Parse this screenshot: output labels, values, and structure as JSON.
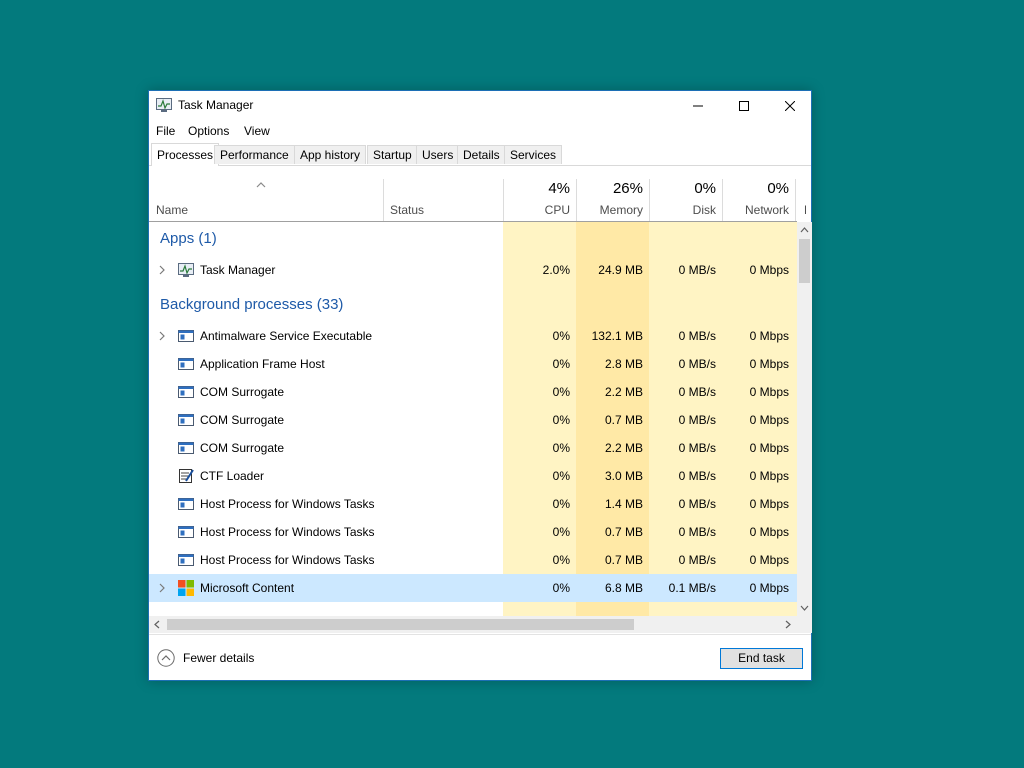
{
  "window": {
    "title": "Task Manager"
  },
  "menu": [
    "File",
    "Options",
    "View"
  ],
  "tabs": [
    "Processes",
    "Performance",
    "App history",
    "Startup",
    "Users",
    "Details",
    "Services"
  ],
  "columns": {
    "name": "Name",
    "status": "Status",
    "cpu": {
      "pct": "4%",
      "label": "CPU"
    },
    "memory": {
      "pct": "26%",
      "label": "Memory"
    },
    "disk": {
      "pct": "0%",
      "label": "Disk"
    },
    "network": {
      "pct": "0%",
      "label": "Network"
    },
    "power": "P"
  },
  "groups": {
    "apps": "Apps (1)",
    "background": "Background processes (33)"
  },
  "apps": [
    {
      "name": "Task Manager",
      "cpu": "2.0%",
      "memory": "24.9 MB",
      "disk": "0 MB/s",
      "network": "0 Mbps",
      "icon": "task-manager-icon",
      "expandable": true
    }
  ],
  "background": [
    {
      "name": "Antimalware Service Executable",
      "cpu": "0%",
      "memory": "132.1 MB",
      "disk": "0 MB/s",
      "network": "0 Mbps",
      "icon": "app-window-icon",
      "expandable": true
    },
    {
      "name": "Application Frame Host",
      "cpu": "0%",
      "memory": "2.8 MB",
      "disk": "0 MB/s",
      "network": "0 Mbps",
      "icon": "app-window-icon",
      "expandable": false
    },
    {
      "name": "COM Surrogate",
      "cpu": "0%",
      "memory": "2.2 MB",
      "disk": "0 MB/s",
      "network": "0 Mbps",
      "icon": "app-window-icon",
      "expandable": false
    },
    {
      "name": "COM Surrogate",
      "cpu": "0%",
      "memory": "0.7 MB",
      "disk": "0 MB/s",
      "network": "0 Mbps",
      "icon": "app-window-icon",
      "expandable": false
    },
    {
      "name": "COM Surrogate",
      "cpu": "0%",
      "memory": "2.2 MB",
      "disk": "0 MB/s",
      "network": "0 Mbps",
      "icon": "app-window-icon",
      "expandable": false
    },
    {
      "name": "CTF Loader",
      "cpu": "0%",
      "memory": "3.0 MB",
      "disk": "0 MB/s",
      "network": "0 Mbps",
      "icon": "ctf-loader-icon",
      "expandable": false
    },
    {
      "name": "Host Process for Windows Tasks",
      "cpu": "0%",
      "memory": "1.4 MB",
      "disk": "0 MB/s",
      "network": "0 Mbps",
      "icon": "app-window-icon",
      "expandable": false
    },
    {
      "name": "Host Process for Windows Tasks",
      "cpu": "0%",
      "memory": "0.7 MB",
      "disk": "0 MB/s",
      "network": "0 Mbps",
      "icon": "app-window-icon",
      "expandable": false
    },
    {
      "name": "Host Process for Windows Tasks",
      "cpu": "0%",
      "memory": "0.7 MB",
      "disk": "0 MB/s",
      "network": "0 Mbps",
      "icon": "app-window-icon",
      "expandable": false
    },
    {
      "name": "Microsoft Content",
      "cpu": "0%",
      "memory": "6.8 MB",
      "disk": "0.1 MB/s",
      "network": "0 Mbps",
      "icon": "microsoft-logo-icon",
      "expandable": true,
      "selected": true
    }
  ],
  "footer": {
    "fewer_details": "Fewer details",
    "end_task": "End task"
  },
  "colors": {
    "desktop": "#037a7d",
    "heat_light": "#fff4c4",
    "heat_medium": "#ffe8a0",
    "selection": "#cce8ff",
    "group_title": "#1e5aa8"
  }
}
